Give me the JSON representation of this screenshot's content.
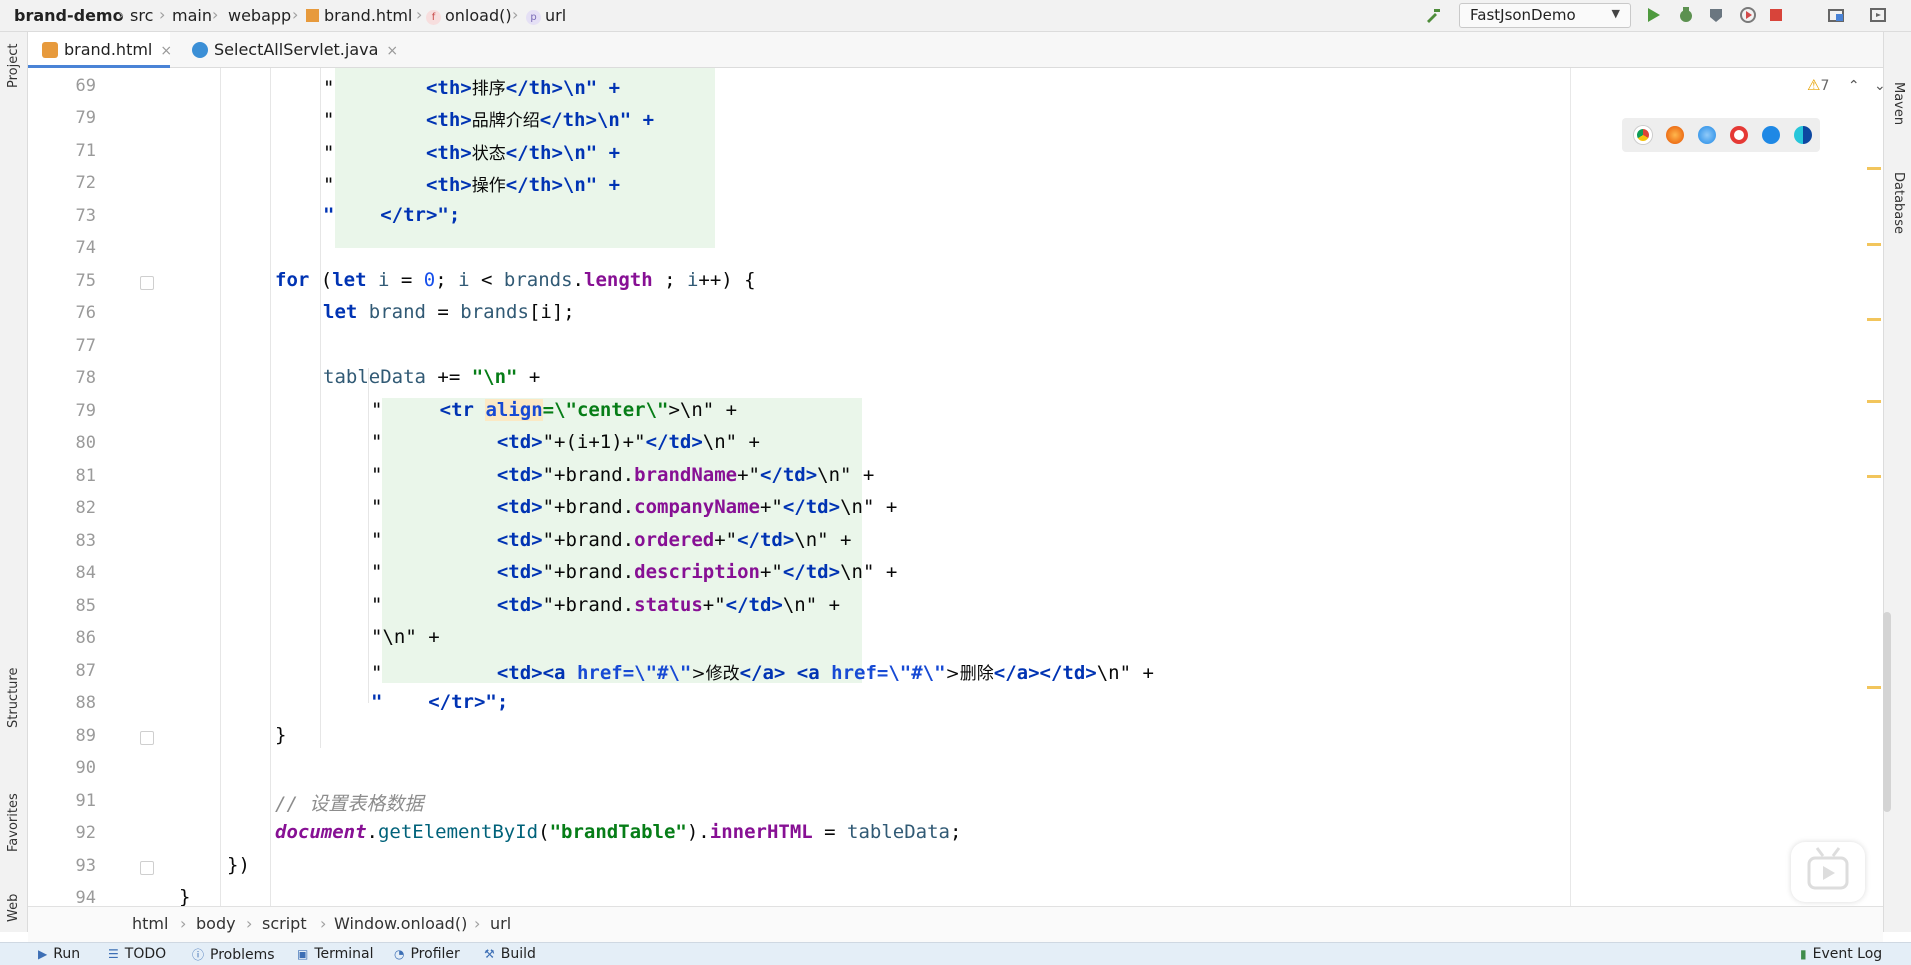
{
  "topbar": {
    "project": "brand-demo",
    "path": [
      "src",
      "main",
      "webapp",
      "brand.html",
      "onload()",
      "url"
    ],
    "run_config": "FastJsonDemo"
  },
  "tabs": [
    {
      "label": "brand.html",
      "active": true
    },
    {
      "label": "SelectAllServlet.java",
      "active": false
    }
  ],
  "left_tools": [
    "Project",
    "Structure",
    "Favorites",
    "Web"
  ],
  "right_tools": [
    "Maven",
    "Database"
  ],
  "editor": {
    "warnings": "7",
    "line_numbers": [
      "69",
      "79",
      "71",
      "72",
      "73",
      "74",
      "75",
      "76",
      "77",
      "78",
      "79",
      "80",
      "81",
      "82",
      "83",
      "84",
      "85",
      "86",
      "87",
      "88",
      "89",
      "90",
      "91",
      "92",
      "93",
      "94"
    ],
    "lines": {
      "l69_a": "\"",
      "l69_b": "<th>",
      "l69_c": "排序",
      "l69_d": "</th>\\n\" +",
      "l70_a": "\"",
      "l70_b": "<th>",
      "l70_c": "品牌介绍",
      "l70_d": "</th>\\n\" +",
      "l71_a": "\"",
      "l71_b": "<th>",
      "l71_c": "状态",
      "l71_d": "</th>\\n\" +",
      "l72_a": "\"",
      "l72_b": "<th>",
      "l72_c": "操作",
      "l72_d": "</th>\\n\" +",
      "l73": "\"    </tr>\";",
      "l75_for": "for",
      "l75_let": "let",
      "l75_i": "i",
      "l75_eq": " = ",
      "l75_zero": "0",
      "l75_rest1": "; ",
      "l75_i2": "i",
      "l75_lt": " < ",
      "l75_brands": "brands",
      "l75_dot": ".",
      "l75_len": "length",
      "l75_rest2": " ; ",
      "l75_i3": "i",
      "l75_rest3": "++) {",
      "l76_let": "let",
      "l76_brand": " brand",
      "l76_eq": " = ",
      "l76_brands": "brands",
      "l76_rest": "[i];",
      "l78_var": "tableData",
      "l78_op": " += ",
      "l78_str": "\"\\n\"",
      "l78_plus": " +",
      "l79_q": "\"",
      "l79_tr": "<tr",
      "l79_attr": "align",
      "l79_val": "=\\\"center\\\"",
      "l79_end": ">\\n\" +",
      "l80_q": "\"",
      "l80_td": "<td>",
      "l80_mid": "\"+(i+1)+\"",
      "l80_ctd": "</td>",
      "l80_end": "\\n\" +",
      "l81_q": "\"",
      "l81_td": "<td>",
      "l81_p1": "\"+brand.",
      "l81_f": "brandName",
      "l81_p2": "+\"",
      "l81_ctd": "</td>",
      "l81_end": "\\n\" +",
      "l82_q": "\"",
      "l82_td": "<td>",
      "l82_p1": "\"+brand.",
      "l82_f": "companyName",
      "l82_p2": "+\"",
      "l82_ctd": "</td>",
      "l82_end": "\\n\" +",
      "l83_q": "\"",
      "l83_td": "<td>",
      "l83_p1": "\"+brand.",
      "l83_f": "ordered",
      "l83_p2": "+\"",
      "l83_ctd": "</td>",
      "l83_end": "\\n\" +",
      "l84_q": "\"",
      "l84_td": "<td>",
      "l84_p1": "\"+brand.",
      "l84_f": "description",
      "l84_p2": "+\"",
      "l84_ctd": "</td>",
      "l84_end": "\\n\" +",
      "l85_q": "\"",
      "l85_td": "<td>",
      "l85_p1": "\"+brand.",
      "l85_f": "status",
      "l85_p2": "+\"",
      "l85_ctd": "</td>",
      "l85_end": "\\n\" +",
      "l86": "\"\\n\" +",
      "l87_q": "\"",
      "l87_tda": "<td><a",
      "l87_href1": "href=\\\"#\\\"",
      "l87_t1": ">修改",
      "l87_ca1": "</a>",
      "l87_a2": "<a",
      "l87_href2": "href=\\\"#\\\"",
      "l87_t2": ">删除",
      "l87_ca2": "</a></td>",
      "l87_end": "\\n\" +",
      "l88": "\"    </tr>\";",
      "l89": "}",
      "l91": "// 设置表格数据",
      "l92_doc": "document",
      "l92_dot": ".",
      "l92_meth": "getElementById",
      "l92_p1": "(",
      "l92_str": "\"brandTable\"",
      "l92_p2": ").",
      "l92_fld": "innerHTML",
      "l92_eq": " = ",
      "l92_var": "tableData",
      "l92_semi": ";",
      "l93": "})",
      "l94": "}"
    }
  },
  "breadcrumb": [
    "html",
    "body",
    "script",
    "Window.onload()",
    "url"
  ],
  "statusbar": {
    "items": [
      "Run",
      "TODO",
      "Problems",
      "Terminal",
      "Profiler",
      "Build"
    ],
    "right": "Event Log"
  }
}
